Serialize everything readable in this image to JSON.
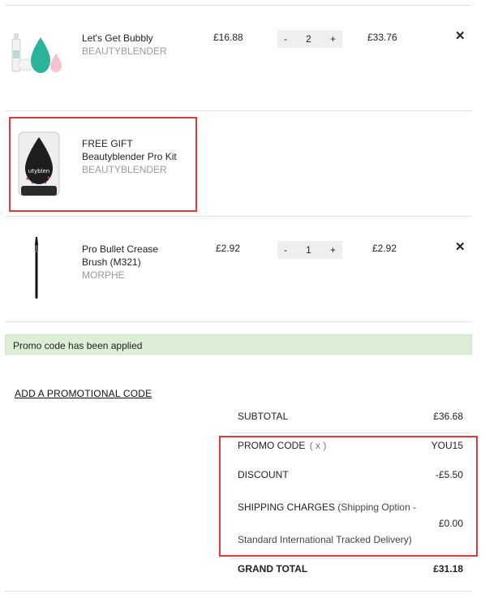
{
  "cart": {
    "items": [
      {
        "name": "Let's Get Bubbly",
        "brand": "BEAUTYBLENDER",
        "price": "£16.88",
        "quantity": "2",
        "total": "£33.76",
        "image_icon": "beautyblender-set-image"
      },
      {
        "name_line1": "FREE GIFT",
        "name_line2": "Beautyblender Pro Kit",
        "brand": "BEAUTYBLENDER",
        "image_icon": "beautyblender-pro-kit-image"
      },
      {
        "name": "Pro Bullet Crease Brush (M321)",
        "brand": "MORPHE",
        "price": "£2.92",
        "quantity": "1",
        "total": "£2.92",
        "image_icon": "makeup-brush-image"
      }
    ],
    "qty_minus": "-",
    "qty_plus": "+",
    "remove_symbol": "✕"
  },
  "promo": {
    "applied_message": "Promo code has been applied",
    "add_link": "ADD A PROMOTIONAL CODE"
  },
  "summary": {
    "subtotal_label": "SUBTOTAL",
    "subtotal_value": "£36.68",
    "promo_label": "PROMO CODE",
    "promo_remove": "( x )",
    "promo_value": "YOU15",
    "discount_label": "DISCOUNT",
    "discount_value": "-£5.50",
    "shipping_label": "SHIPPING CHARGES",
    "shipping_option_1": "(Shipping Option -",
    "shipping_option_2": "Standard International Tracked Delivery)",
    "shipping_value": "£0.00",
    "grand_total_label": "GRAND TOTAL",
    "grand_total_value": "£31.18"
  },
  "colors": {
    "highlight_border": "#e0393e",
    "promo_bg": "#dcefd6",
    "brand_text": "#9a9a9a"
  }
}
